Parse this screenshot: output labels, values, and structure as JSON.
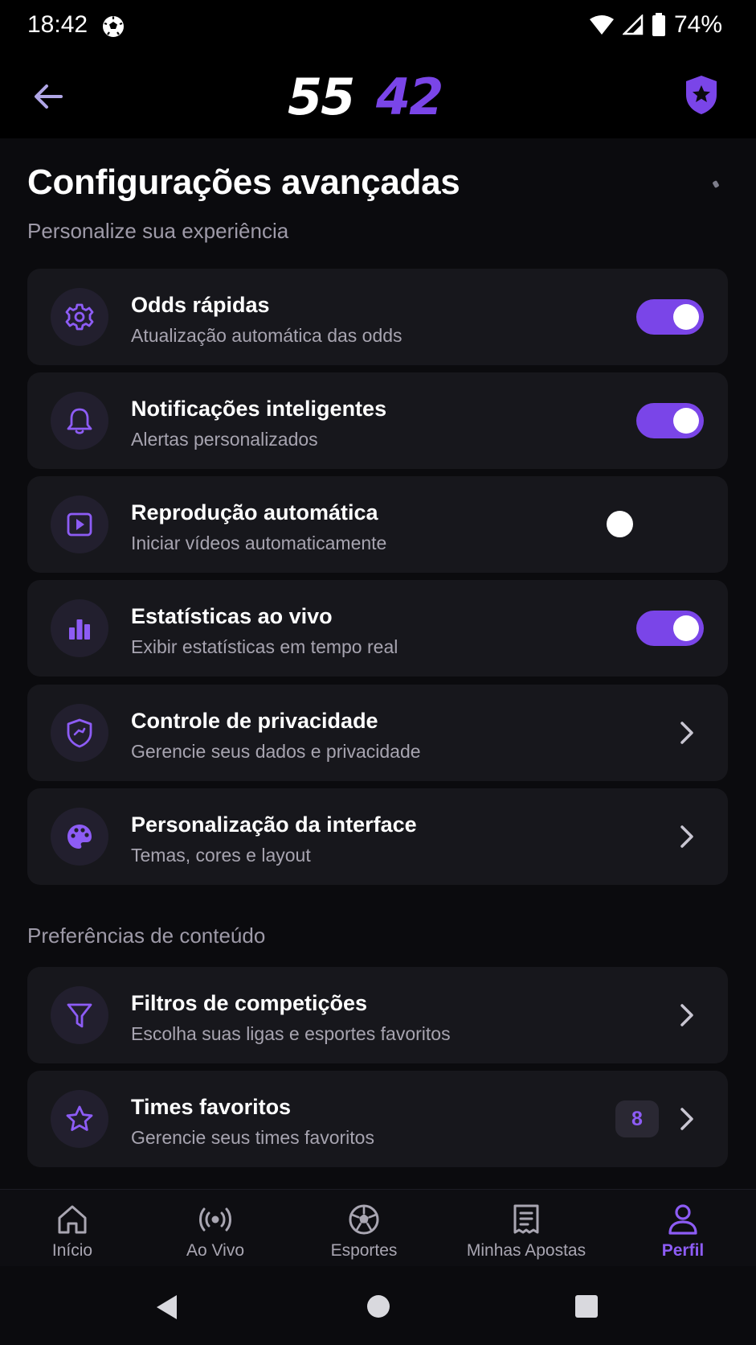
{
  "status_bar": {
    "time": "18:42",
    "battery": "74%",
    "notification_icon": "soccer-ball-icon"
  },
  "app_bar": {
    "logo_left": "55",
    "logo_right": "42",
    "brand_color": "#7a45e8"
  },
  "page": {
    "title": "Configurações avançadas",
    "subtitle": "Personalize sua experiência"
  },
  "settings": [
    {
      "icon": "gear-icon",
      "title": "Odds rápidas",
      "subtitle": "Atualização automática das odds",
      "control": "toggle",
      "enabled": true
    },
    {
      "icon": "bell-icon",
      "title": "Notificações inteligentes",
      "subtitle": "Alertas personalizados",
      "control": "toggle",
      "enabled": true
    },
    {
      "icon": "play-icon",
      "title": "Reprodução automática",
      "subtitle": "Iniciar vídeos automaticamente",
      "control": "toggle",
      "enabled": false
    },
    {
      "icon": "bar-chart-icon",
      "title": "Estatísticas ao vivo",
      "subtitle": "Exibir estatísticas em tempo real",
      "control": "toggle",
      "enabled": true
    },
    {
      "icon": "shield-icon",
      "title": "Controle de privacidade",
      "subtitle": "Gerencie seus dados e privacidade",
      "control": "chevron"
    },
    {
      "icon": "palette-icon",
      "title": "Personalização da interface",
      "subtitle": "Temas, cores e layout",
      "control": "chevron"
    }
  ],
  "content_section": {
    "label": "Preferências de conteúdo",
    "items": [
      {
        "icon": "filter-icon",
        "title": "Filtros de competições",
        "subtitle": "Escolha suas ligas e esportes favoritos",
        "control": "chevron"
      },
      {
        "icon": "star-icon",
        "title": "Times favoritos",
        "subtitle": "Gerencie seus times favoritos",
        "control": "chevron",
        "badge": "8"
      }
    ]
  },
  "bottom_nav": [
    {
      "label": "Início",
      "icon": "home-icon",
      "active": false
    },
    {
      "label": "Ao Vivo",
      "icon": "live-broadcast-icon",
      "active": false
    },
    {
      "label": "Esportes",
      "icon": "soccer-ball-icon",
      "active": false
    },
    {
      "label": "Minhas Apostas",
      "icon": "receipt-icon",
      "active": false
    },
    {
      "label": "Perfil",
      "icon": "user-icon",
      "active": true
    }
  ],
  "colors": {
    "accent": "#7a45e8",
    "accent_text": "#8d5cf5",
    "card": "#17171c",
    "background": "#0b0b0e"
  }
}
